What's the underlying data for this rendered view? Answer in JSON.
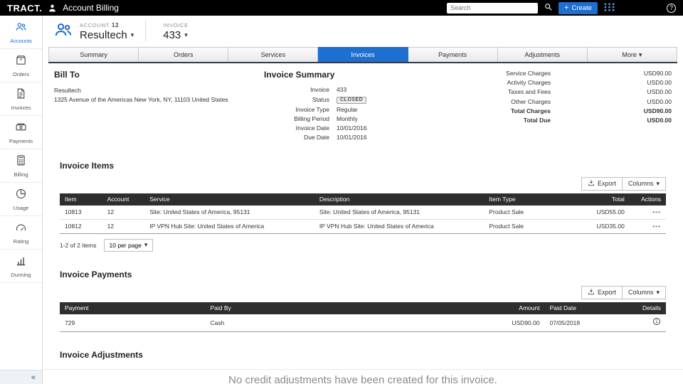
{
  "colors": {
    "accent": "#1e6fd0",
    "topbar_bg": "#000000",
    "table_header_bg": "#2e2e2e",
    "tab_underline": "#2f3e4e"
  },
  "icons": {
    "caret": "▾",
    "ellipsis": "•••"
  },
  "topbar": {
    "logo": "TRACT.",
    "title": "Account Billing",
    "search_placeholder": "Search",
    "create_label": "Create",
    "help_label": "?"
  },
  "sidebar": {
    "items": [
      {
        "label": "Accounts"
      },
      {
        "label": "Orders"
      },
      {
        "label": "Invoices"
      },
      {
        "label": "Payments"
      },
      {
        "label": "Billing"
      },
      {
        "label": "Usage"
      },
      {
        "label": "Rating"
      },
      {
        "label": "Dunning"
      }
    ],
    "collapse_label": "«"
  },
  "header": {
    "account_label": "ACCOUNT",
    "account_number": "12",
    "account_name": "Resultech",
    "invoice_label": "INVOICE",
    "invoice_number": "433"
  },
  "tabs": {
    "items": [
      {
        "label": "Summary"
      },
      {
        "label": "Orders"
      },
      {
        "label": "Services"
      },
      {
        "label": "Invoices"
      },
      {
        "label": "Payments"
      },
      {
        "label": "Adjustments"
      },
      {
        "label": "More"
      }
    ]
  },
  "bill_to": {
    "heading": "Bill To",
    "name": "Resultech",
    "address_line": "1325 Avenue of the Americas New York, NY, 11103 United States"
  },
  "invoice_summary": {
    "heading": "Invoice Summary",
    "fields": [
      {
        "label": "Invoice",
        "value": "433"
      },
      {
        "label": "Status",
        "value": "CLOSED"
      },
      {
        "label": "Invoice Type",
        "value": "Regular"
      },
      {
        "label": "Billing Period",
        "value": "Monthly"
      },
      {
        "label": "Invoice Date",
        "value": "10/01/2016"
      },
      {
        "label": "Due Date",
        "value": "10/01/2016"
      }
    ],
    "charges": [
      {
        "label": "Service Charges",
        "value": "USD90.00"
      },
      {
        "label": "Activity Charges",
        "value": "USD0.00"
      },
      {
        "label": "Taxes and Fees",
        "value": "USD0.00"
      },
      {
        "label": "Other Charges",
        "value": "USD0.00"
      },
      {
        "label": "Total Charges",
        "value": "USD90.00"
      },
      {
        "label": "Total Due",
        "value": "USD0.00"
      }
    ]
  },
  "invoice_items": {
    "heading": "Invoice Items",
    "export_label": "Export",
    "columns_label": "Columns",
    "headers": {
      "item": "Item",
      "account": "Account",
      "service": "Service",
      "description": "Description",
      "item_type": "Item Type",
      "total": "Total",
      "actions": "Actions"
    },
    "rows": [
      {
        "item": "10813",
        "account": "12",
        "service": "Site: United States of America, 95131",
        "description": "Site: United States of America, 95131",
        "item_type": "Product Sale",
        "total": "USD55.00"
      },
      {
        "item": "10812",
        "account": "12",
        "service": "IP VPN Hub Site: United States of America",
        "description": "IP VPN Hub Site: United States of America",
        "item_type": "Product Sale",
        "total": "USD35.00"
      }
    ],
    "pagination_text": "1-2 of 2 items",
    "per_page_label": "10 per page"
  },
  "invoice_payments": {
    "heading": "Invoice Payments",
    "export_label": "Export",
    "columns_label": "Columns",
    "headers": {
      "payment": "Payment",
      "paid_by": "Paid By",
      "amount": "Amount",
      "paid_date": "Paid Date",
      "details": "Details"
    },
    "rows": [
      {
        "payment": "729",
        "paid_by": "Cash",
        "amount": "USD90.00",
        "paid_date": "07/05/2018"
      }
    ]
  },
  "invoice_adjustments": {
    "heading": "Invoice Adjustments",
    "empty_message": "No credit adjustments have been created for this invoice."
  }
}
